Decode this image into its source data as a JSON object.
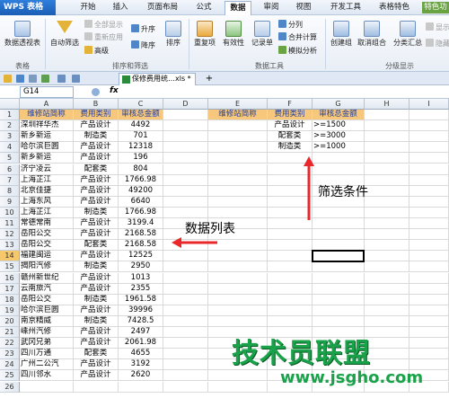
{
  "menubar": {
    "app_label": "WPS 表格",
    "items": [
      "开始",
      "插入",
      "页面布局",
      "公式",
      "数据",
      "审阅",
      "视图",
      "开发工具",
      "表格特色",
      "特色功"
    ],
    "active": "数据"
  },
  "ribbon": {
    "pivot": "数据透视表",
    "autofilter": "自动筛选",
    "show_all": "全部显示",
    "reapply": "重新应用",
    "advanced": "高级",
    "sort_asc": "升序",
    "sort_desc": "降序",
    "sort": "排序",
    "duplicates": "重复项",
    "validity": "有效性",
    "record": "记录单",
    "split": "分列",
    "merge_calc": "合并计算",
    "simulate": "模拟分析",
    "group_create": "创建组",
    "group_cancel": "取消组合",
    "subtotal": "分类汇总",
    "show_detail": "显示明细",
    "hide_detail": "隐藏明细",
    "group_table": "表格",
    "group_sort_filter": "排序和筛选",
    "group_data_tools": "数据工具",
    "group_outline": "分级显示"
  },
  "tabs": {
    "doc_tab": "保修费用统…xls *",
    "new_tab": "+"
  },
  "formula_bar": {
    "name_box": "G14",
    "fx": "fx",
    "content": ""
  },
  "grid": {
    "columns": [
      "A",
      "B",
      "C",
      "D",
      "E",
      "F",
      "G",
      "H",
      "I"
    ],
    "rows": [
      "1",
      "2",
      "3",
      "4",
      "5",
      "6",
      "7",
      "8",
      "9",
      "10",
      "11",
      "12",
      "13",
      "14",
      "15",
      "16",
      "17",
      "18",
      "19",
      "20",
      "21",
      "22",
      "23",
      "24",
      "25",
      "26"
    ],
    "active_row": "14",
    "headers": [
      "维修站简称",
      "费用类别",
      "审核总金额"
    ],
    "data": [
      [
        "深圳祥华杰",
        "产品设计",
        "4492"
      ],
      [
        "新乡新运",
        "制造类",
        "701"
      ],
      [
        "哈尔滨巨圆",
        "产品设计",
        "12318"
      ],
      [
        "新乡新运",
        "产品设计",
        "196"
      ],
      [
        "济宁凌云",
        "配套类",
        "804"
      ],
      [
        "上海芷江",
        "产品设计",
        "1766.98"
      ],
      [
        "北京佳捷",
        "产品设计",
        "49200"
      ],
      [
        "上海东风",
        "产品设计",
        "6640"
      ],
      [
        "上海芷江",
        "制造类",
        "1766.98"
      ],
      [
        "常德常南",
        "产品设计",
        "3199.4"
      ],
      [
        "岳阳公交",
        "产品设计",
        "2168.58"
      ],
      [
        "岳阳公交",
        "配套类",
        "2168.58"
      ],
      [
        "福建闽运",
        "产品设计",
        "12525"
      ],
      [
        "揭阳汽修",
        "制造类",
        "2950"
      ],
      [
        "赣州新世纪",
        "产品设计",
        "1013"
      ],
      [
        "云南旅汽",
        "产品设计",
        "2355"
      ],
      [
        "岳阳公交",
        "制造类",
        "1961.58"
      ],
      [
        "哈尔滨巨圆",
        "产品设计",
        "39996"
      ],
      [
        "南京精威",
        "制造类",
        "7428.5"
      ],
      [
        "嵊州汽修",
        "产品设计",
        "2497"
      ],
      [
        "武冈兄弟",
        "产品设计",
        "2061.98"
      ],
      [
        "四川万通",
        "配套类",
        "4655"
      ],
      [
        "广州二公汽",
        "产品设计",
        "3192"
      ],
      [
        "四川邻水",
        "产品设计",
        "2620"
      ]
    ],
    "criteria_headers": [
      "维修站简称",
      "费用类别",
      "审核总金额"
    ],
    "criteria": [
      [
        "",
        "产品设计",
        ">=1500"
      ],
      [
        "",
        "配套类",
        ">=3000"
      ],
      [
        "",
        "制造类",
        ">=1000"
      ]
    ]
  },
  "annotations": {
    "filter_label": "筛选条件",
    "list_label": "数据列表",
    "watermark": "技术员联盟",
    "watermark_url": "www.jsgho.com",
    "arrow_color": "#e8282b"
  }
}
